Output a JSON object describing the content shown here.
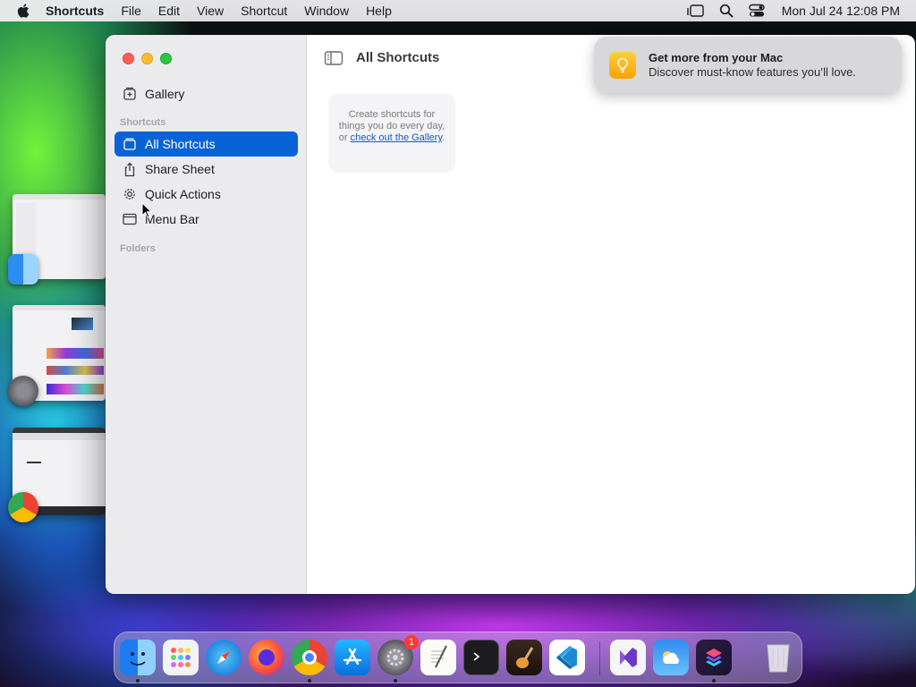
{
  "menubar": {
    "app_name": "Shortcuts",
    "items": [
      "File",
      "Edit",
      "View",
      "Shortcut",
      "Window",
      "Help"
    ],
    "clock": "Mon Jul 24  12:08 PM",
    "status_icons": [
      "stage-manager-icon",
      "spotlight-search-icon",
      "control-center-icon"
    ]
  },
  "window": {
    "title": "All Shortcuts",
    "sidebar": {
      "gallery_label": "Gallery",
      "section_shortcuts": "Shortcuts",
      "items": [
        {
          "label": "All Shortcuts",
          "icon": "stack-icon",
          "selected": true
        },
        {
          "label": "Share Sheet",
          "icon": "share-icon",
          "selected": false
        },
        {
          "label": "Quick Actions",
          "icon": "gear-icon",
          "selected": false
        },
        {
          "label": "Menu Bar",
          "icon": "menubar-icon",
          "selected": false
        }
      ],
      "section_folders": "Folders"
    },
    "empty_card": {
      "text": "Create shortcuts for things you do every day, or",
      "link": "check out the Gallery",
      "suffix": "."
    }
  },
  "notification": {
    "title": "Get more from your Mac",
    "body": "Discover must-know features you’ll love.",
    "icon": "lightbulb-icon"
  },
  "dock": {
    "apps": [
      {
        "name": "Finder",
        "running": true
      },
      {
        "name": "Launchpad",
        "running": false
      },
      {
        "name": "Safari",
        "running": false
      },
      {
        "name": "Firefox",
        "running": false
      },
      {
        "name": "Chrome",
        "running": true
      },
      {
        "name": "App Store",
        "running": false
      },
      {
        "name": "System Settings",
        "running": true,
        "badge": "1"
      },
      {
        "name": "TextEdit",
        "running": false
      },
      {
        "name": "Terminal",
        "running": false
      },
      {
        "name": "GarageBand",
        "running": false
      },
      {
        "name": "Visual Studio Code",
        "running": false
      },
      {
        "name": "Visual Studio",
        "running": false
      },
      {
        "name": "Weather",
        "running": false
      },
      {
        "name": "Shortcuts",
        "running": true
      },
      {
        "name": "Trash",
        "running": false
      }
    ]
  },
  "colors": {
    "accent": "#0a63d6",
    "link": "#0a5bd0",
    "badge": "#ff3b30"
  }
}
